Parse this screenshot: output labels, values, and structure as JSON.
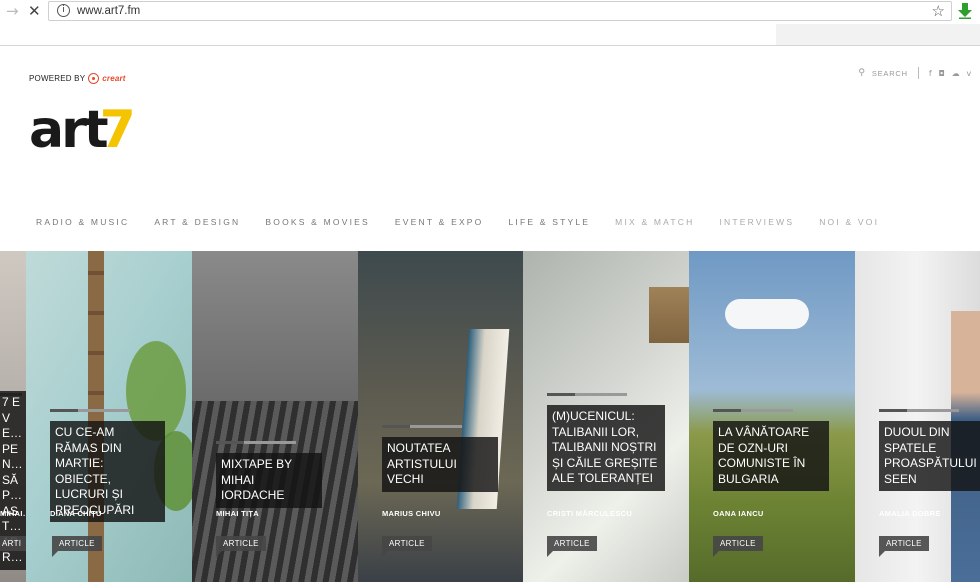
{
  "browser": {
    "url": "www.art7.fm"
  },
  "header": {
    "powered_prefix": "POWERED BY",
    "powered_brand": "creart",
    "logo_main": "art",
    "logo_accent": "7",
    "search_label": "SEARCH"
  },
  "menu": [
    {
      "label": "RADIO & MUSIC"
    },
    {
      "label": "ART & DESIGN"
    },
    {
      "label": "BOOKS & MOVIES"
    },
    {
      "label": "EVENT & EXPO"
    },
    {
      "label": "LIFE & STYLE"
    },
    {
      "label": "MIX & MATCH"
    },
    {
      "label": "INTERVIEWS"
    },
    {
      "label": "NOI & VOI"
    }
  ],
  "tiles": [
    {
      "title": "7 EVE… PEN… SĂP… AST… APR…",
      "author": "MIHAI…",
      "badge": "ARTI"
    },
    {
      "title": "CU CE-AM RĂMAS DIN MARTIE: OBIECTE, LUCRURI ȘI PREOCUPĂRI",
      "author": "DIANA CHIȚU",
      "badge": "ARTICLE"
    },
    {
      "title": "MIXTAPE BY MIHAI IORDACHE",
      "author": "MIHAI TIȚA",
      "badge": "ARTICLE"
    },
    {
      "title": "NOUTATEA ARTISTULUI VECHI",
      "author": "MARIUS CHIVU",
      "badge": "ARTICLE"
    },
    {
      "title": "(M)UCENICUL: TALIBANII LOR, TALIBANII NOȘTRI ȘI CĂILE GREȘITE ALE TOLERANȚEI",
      "author": "CRISTI MĂRCULESCU",
      "badge": "ARTICLE"
    },
    {
      "title": "LA VÂNĂTOARE DE OZN-URI COMUNISTE ÎN BULGARIA",
      "author": "OANA IANCU",
      "badge": "ARTICLE"
    },
    {
      "title": "DUOUL DIN SPATELE PROASPĂTULUI SEEN",
      "author": "AMALIA DOBRE",
      "badge": "ARTICLE"
    }
  ],
  "colors": {
    "logo_accent": "#f5c400",
    "creart_red": "#e8492b",
    "download_green": "#2e9e2e"
  }
}
